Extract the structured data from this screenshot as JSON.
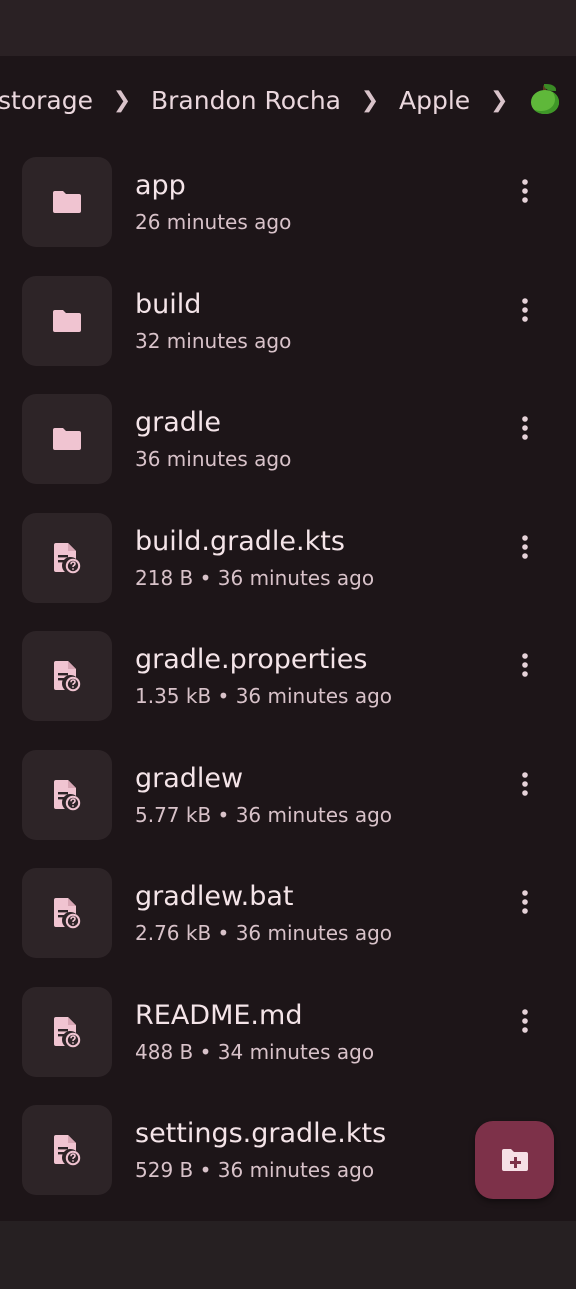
{
  "breadcrumb": {
    "items": [
      "storage",
      "Brandon Rocha",
      "Apple"
    ],
    "current_icon": "green-apple-icon",
    "separator_icon": "chevron-right-icon"
  },
  "files": [
    {
      "name": "app",
      "meta": "26 minutes ago",
      "kind": "folder",
      "icon": "folder-icon"
    },
    {
      "name": "build",
      "meta": "32 minutes ago",
      "kind": "folder",
      "icon": "folder-icon"
    },
    {
      "name": "gradle",
      "meta": "36 minutes ago",
      "kind": "folder",
      "icon": "folder-icon"
    },
    {
      "name": "build.gradle.kts",
      "meta": "218 B • 36 minutes ago",
      "kind": "file",
      "icon": "unknown-file-icon"
    },
    {
      "name": "gradle.properties",
      "meta": "1.35 kB • 36 minutes ago",
      "kind": "file",
      "icon": "unknown-file-icon"
    },
    {
      "name": "gradlew",
      "meta": "5.77 kB • 36 minutes ago",
      "kind": "file",
      "icon": "unknown-file-icon"
    },
    {
      "name": "gradlew.bat",
      "meta": "2.76 kB • 36 minutes ago",
      "kind": "file",
      "icon": "unknown-file-icon"
    },
    {
      "name": "README.md",
      "meta": "488 B • 34 minutes ago",
      "kind": "file",
      "icon": "unknown-file-icon"
    },
    {
      "name": "settings.gradle.kts",
      "meta": "529 B • 36 minutes ago",
      "kind": "file",
      "icon": "unknown-file-icon"
    }
  ],
  "fab": {
    "icon": "new-folder-icon"
  },
  "colors": {
    "background": "#1d1518",
    "thumb": "#2d2427",
    "icon_tint": "#f0c4d1",
    "fab": "#7d3149"
  }
}
